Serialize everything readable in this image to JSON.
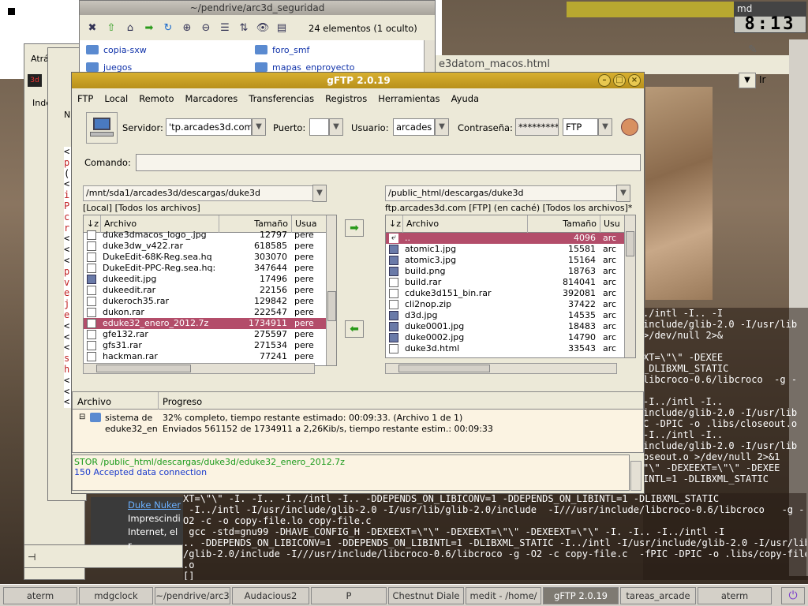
{
  "desktop": {
    "clock_title": "md",
    "clock_time": "8:13",
    "back_label": "Atrás",
    "left_labels": [
      "Inde",
      "Nu"
    ],
    "side_letters": [
      "<",
      "p",
      "(",
      "<",
      "i",
      "P",
      "c",
      "r",
      "<",
      "<",
      "<",
      "p",
      "v",
      "e",
      "j",
      "e",
      "<",
      "<",
      "<",
      "s",
      "h",
      "<",
      "<",
      "<"
    ],
    "html_tab": "e3datom_macos.html",
    "ir_label": "Ir",
    "duke_link": "Duke Nuker",
    "impresc": "Imprescindi",
    "internet": "Internet, el r"
  },
  "nautilus": {
    "title": "~/pendrive/arc3d_seguridad",
    "status": "24 elementos (1 oculto)",
    "folders": [
      "copia-sxw",
      "foro_smf",
      "juegos",
      "mapas_enproyecto"
    ]
  },
  "gftp": {
    "title": "gFTP 2.0.19",
    "menu": [
      "FTP",
      "Local",
      "Remoto",
      "Marcadores",
      "Transferencias",
      "Registros",
      "Herramientas",
      "Ayuda"
    ],
    "server_label": "Servidor:",
    "server_value": "'tp.arcades3d.com",
    "port_label": "Puerto:",
    "port_value": "",
    "user_label": "Usuario:",
    "user_value": "arcades",
    "pass_label": "Contraseña:",
    "pass_value": "**********",
    "protocol": "FTP",
    "command_label": "Comando:",
    "command_value": "",
    "local": {
      "path": "/mnt/sda1/arcades3d/descargas/duke3d",
      "status": "[Local] [Todos los archivos]",
      "columns": [
        "Archivo",
        "Tamaño",
        "Usua"
      ],
      "rows": [
        {
          "name": "duke3dmacos_logo_.jpg",
          "size": "12797",
          "user": "pere",
          "icon": "file"
        },
        {
          "name": "duke3dw_v422.rar",
          "size": "618585",
          "user": "pere",
          "icon": "file"
        },
        {
          "name": "DukeEdit-68K-Reg.sea.hq",
          "size": "303070",
          "user": "pere",
          "icon": "file"
        },
        {
          "name": "DukeEdit-PPC-Reg.sea.hq:",
          "size": "347644",
          "user": "pere",
          "icon": "file"
        },
        {
          "name": "dukeedit.jpg",
          "size": "17496",
          "user": "pere",
          "icon": "img"
        },
        {
          "name": "dukeedit.rar",
          "size": "22156",
          "user": "pere",
          "icon": "file"
        },
        {
          "name": "dukeroch35.rar",
          "size": "129842",
          "user": "pere",
          "icon": "file"
        },
        {
          "name": "dukon.rar",
          "size": "222547",
          "user": "pere",
          "icon": "file"
        },
        {
          "name": "eduke32_enero_2012.7z",
          "size": "1734911",
          "user": "pere",
          "icon": "file",
          "selected": true
        },
        {
          "name": "gfe132.rar",
          "size": "275597",
          "user": "pere",
          "icon": "file"
        },
        {
          "name": "gfs31.rar",
          "size": "271534",
          "user": "pere",
          "icon": "file"
        },
        {
          "name": "hackman.rar",
          "size": "77241",
          "user": "pere",
          "icon": "file"
        }
      ]
    },
    "remote": {
      "path": "/public_html/descargas/duke3d",
      "status": "ftp.arcades3d.com [FTP] (en caché) [Todos los archivos]*",
      "columns": [
        "Archivo",
        "Tamaño",
        "Usu"
      ],
      "rows": [
        {
          "name": "..",
          "size": "4096",
          "user": "arc",
          "icon": "up",
          "selected": true
        },
        {
          "name": "atomic1.jpg",
          "size": "15581",
          "user": "arc",
          "icon": "img"
        },
        {
          "name": "atomic3.jpg",
          "size": "15164",
          "user": "arc",
          "icon": "img"
        },
        {
          "name": "build.png",
          "size": "18763",
          "user": "arc",
          "icon": "img"
        },
        {
          "name": "build.rar",
          "size": "814041",
          "user": "arc",
          "icon": "file"
        },
        {
          "name": "cduke3d151_bin.rar",
          "size": "392081",
          "user": "arc",
          "icon": "file"
        },
        {
          "name": "cli2nop.zip",
          "size": "37422",
          "user": "arc",
          "icon": "file"
        },
        {
          "name": "d3d.jpg",
          "size": "14535",
          "user": "arc",
          "icon": "img"
        },
        {
          "name": "duke0001.jpg",
          "size": "18483",
          "user": "arc",
          "icon": "img"
        },
        {
          "name": "duke0002.jpg",
          "size": "14790",
          "user": "arc",
          "icon": "img"
        },
        {
          "name": "duke3d.html",
          "size": "33543",
          "user": "arc",
          "icon": "file"
        }
      ]
    },
    "transfer": {
      "columns": [
        "Archivo",
        "Progreso"
      ],
      "row1_file": "sistema de",
      "row1_progress": "32% completo, tiempo restante estimado: 00:09:33. (Archivo 1 de 1)",
      "row2_file": "eduke32_en",
      "row2_progress": "Enviados 561152 de 1734911 a 2,26Kib/s, tiempo restante estim.: 00:09:33"
    },
    "log": [
      {
        "text": "STOR /public_html/descargas/duke3d/eduke32_enero_2012.7z",
        "color": "#1a9a1a"
      },
      {
        "text": "150 Accepted data connection",
        "color": "#1a3acc"
      }
    ]
  },
  "terminal": {
    "right_lines": [
      "./intl -I.. -I",
      "include/glib-2.0 -I/usr/lib",
      ">/dev/null 2>&",
      "",
      "XT=\\\"\\\" -DEXEE",
      "_DLIBXML_STATIC",
      "libcroco-0.6/libcroco  -g -",
      "",
      "-I../intl -I..",
      "include/glib-2.0 -I/usr/lib",
      "C -DPIC -o .libs/closeout.o",
      "-I../intl -I..",
      "include/glib-2.0 -I/usr/lib",
      "oseout.o >/dev/null 2>&1",
      "\"\\\" -DEXEEXT=\\\"\\\" -DEXEE",
      "INTL=1 -DLIBXML_STATIC"
    ],
    "bottom_lines": [
      "XT=\\\"\\\" -I. -I.. -I../intl -I.. -DDEPENDS_ON_LIBICONV=1 -DDEPENDS_ON_LIBINTL=1 -DLIBXML_STATIC",
      " -I../intl -I/usr/include/glib-2.0 -I/usr/lib/glib-2.0/include  -I///usr/include/libcroco-0.6/libcroco   -g -",
      "O2 -c -o copy-file.lo copy-file.c",
      " gcc -std=gnu99 -DHAVE_CONFIG_H -DEXEEXT=\\\"\\\" -DEXEEXT=\\\"\\\" -DEXEEXT=\\\"\\\" -I. -I.. -I../intl -I",
      ".. -DDEPENDS_ON_LIBICONV=1 -DDEPENDS_ON_LIBINTL=1 -DLIBXML_STATIC -I../intl -I/usr/include/glib-2.0 -I/usr/lib",
      "/glib-2.0/include -I///usr/include/libcroco-0.6/libcroco -g -O2 -c copy-file.c  -fPIC -DPIC -o .libs/copy-file",
      ".o",
      "[]"
    ]
  },
  "taskbar": {
    "items": [
      {
        "label": "aterm",
        "active": false
      },
      {
        "label": "mdgclock",
        "active": false
      },
      {
        "label": "~/pendrive/arc3",
        "active": false
      },
      {
        "label": "Audacious2",
        "active": false
      },
      {
        "label": "P",
        "active": false
      },
      {
        "label": "Chestnut Diale",
        "active": false
      },
      {
        "label": "medit - /home/",
        "active": false
      },
      {
        "label": "gFTP 2.0.19",
        "active": true
      },
      {
        "label": "tareas_arcade",
        "active": false
      },
      {
        "label": "aterm",
        "active": false
      }
    ]
  }
}
